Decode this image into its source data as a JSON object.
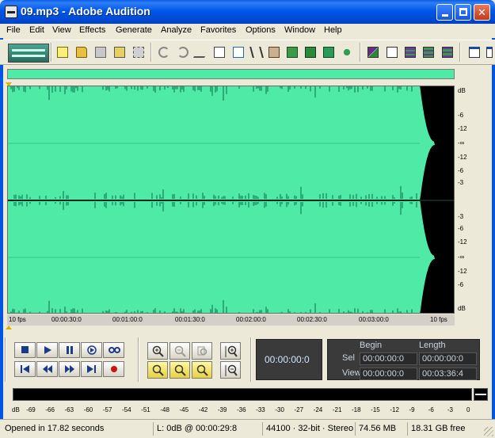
{
  "window": {
    "title": "09.mp3 - Adobe Audition",
    "min_label": "",
    "max_label": "",
    "close_label": "✕"
  },
  "menu": [
    "File",
    "Edit",
    "View",
    "Effects",
    "Generate",
    "Analyze",
    "Favorites",
    "Options",
    "Window",
    "Help"
  ],
  "toolbar": {
    "buttons": [
      "new",
      "open",
      "save",
      "save-all",
      "save-selection",
      "undo",
      "redo",
      "repeat",
      "copy",
      "copy-to-new",
      "cut",
      "paste",
      "paste-to-new",
      "mix-paste",
      "trim",
      "zoom-snap",
      "spectral",
      "waveform",
      "edit-view",
      "multitrack",
      "cd-view",
      "session-view"
    ]
  },
  "waveform": {
    "colors": {
      "background": "#4eeaa6",
      "wave": "#0b6e4a",
      "silence": "#000000",
      "divider": "#0a2a20"
    },
    "db_ruler_top": [
      "dB",
      "-6",
      "-12",
      "-∞",
      "-12",
      "-6",
      "-3"
    ],
    "db_ruler_bottom": [
      "-3",
      "-6",
      "-12",
      "-∞",
      "-12",
      "-6",
      "dB"
    ],
    "time_labels": [
      "10 fps",
      "00:00:30:0",
      "00:01:00:0",
      "00:01:30:0",
      "00:02:00:0",
      "00:02:30:0",
      "00:03:00:0",
      "10 fps"
    ]
  },
  "transport": {
    "time": "00:00:00:0",
    "begin_header": "Begin",
    "length_header": "Length",
    "sel_label": "Sel",
    "view_label": "View",
    "sel_begin": "00:00:00:0",
    "sel_length": "00:00:00:0",
    "view_begin": "00:00:00:0",
    "view_length": "00:03:36:4"
  },
  "meter": {
    "labels": [
      "dB",
      "-69",
      "-66",
      "-63",
      "-60",
      "-57",
      "-54",
      "-51",
      "-48",
      "-45",
      "-42",
      "-39",
      "-36",
      "-33",
      "-30",
      "-27",
      "-24",
      "-21",
      "-18",
      "-15",
      "-12",
      "-9",
      "-6",
      "-3",
      "0"
    ]
  },
  "status": {
    "opened": "Opened in 17.82 seconds",
    "level": "L: 0dB @ 00:00:29:8",
    "format": "44100 · 32-bit · Stereo",
    "size": "74.56 MB",
    "free": "18.31 GB free"
  }
}
